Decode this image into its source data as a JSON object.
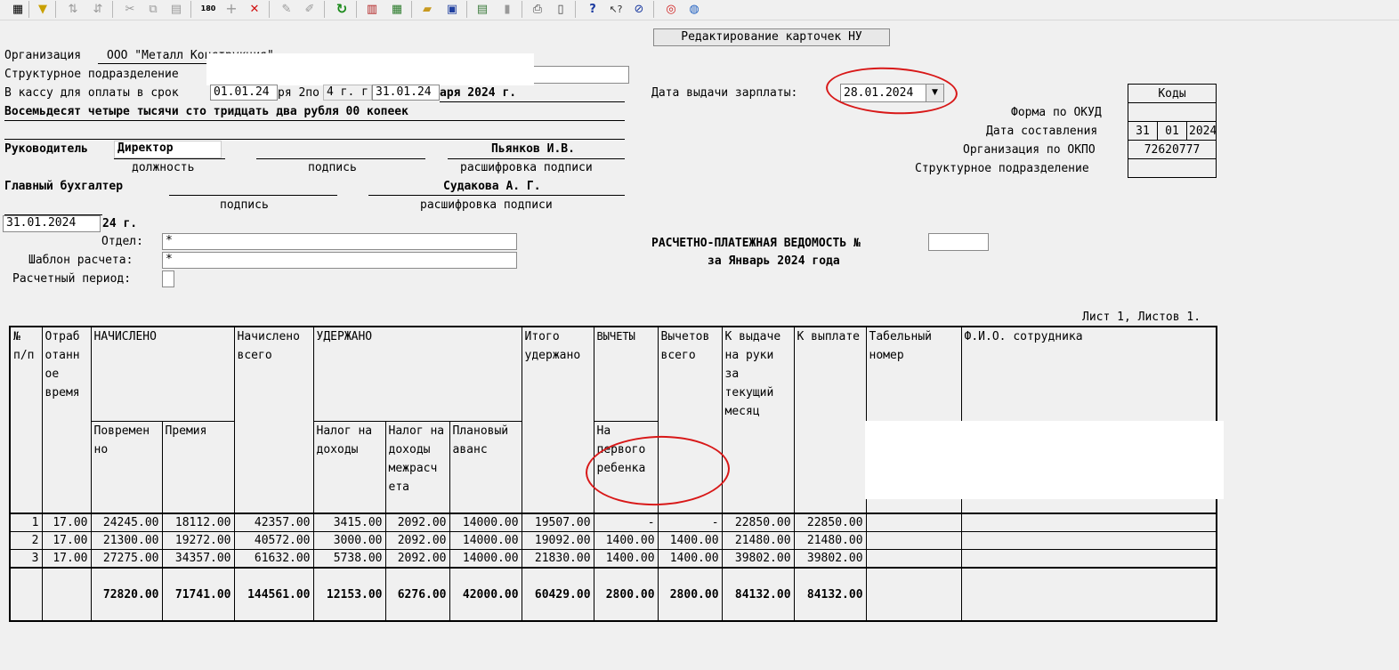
{
  "toolbar": {
    "icons": [
      "grid-icon",
      "filter-icon",
      "sort-asc-icon",
      "sort-desc-icon",
      "cut-icon",
      "copy-icon",
      "paste-icon",
      "counter-icon",
      "add-icon",
      "delete-icon",
      "pencil-icon",
      "edit-field-icon",
      "refresh-icon",
      "report-icon",
      "calculator-icon",
      "open-folder-icon",
      "save-icon",
      "export-icon",
      "document-icon",
      "print-icon",
      "preview-icon",
      "help-icon",
      "context-help-icon",
      "compass-icon",
      "lifebuoy-icon",
      "globe-icon"
    ],
    "counter_label": "180"
  },
  "title_button": "Редактирование карточек НУ",
  "org": {
    "label": "Организация",
    "value": "ООО \"Металл Конструкция\""
  },
  "subdivision": {
    "label": "Структурное подразделение",
    "value": ""
  },
  "cash": {
    "label": "В кассу для оплаты в срок",
    "from": "01.01.24",
    "mid_text": "ря 2по",
    "mid_text2": "4 г. г",
    "to": "31.01.24",
    "tail": "аря 2024 г."
  },
  "amount_words": "Восемьдесят четыре тысячи сто тридцать два рубля 00 копеек",
  "head": {
    "label": "Руководитель",
    "position": "Директор",
    "name": "Пьянков И.В.",
    "cap_position": "должность",
    "cap_signature": "подпись",
    "cap_decode": "расшифровка подписи"
  },
  "accountant": {
    "label": "Главный бухгалтер",
    "name": "Судакова А. Г.",
    "cap_signature": "подпись",
    "cap_decode": "расшифровка подписи"
  },
  "doc_date": {
    "value": "31.01.2024",
    "suffix": "24 г."
  },
  "dept": {
    "label": "Отдел:",
    "value": "*"
  },
  "template": {
    "label": "Шаблон расчета:",
    "value": "*"
  },
  "period": {
    "label": "Расчетный период:"
  },
  "pay_date": {
    "label": "Дата выдачи зарплаты:",
    "value": "28.01.2024"
  },
  "codes": {
    "header": "Коды",
    "okud_label": "Форма по ОКУД",
    "okud": "",
    "date_label": "Дата составления",
    "day": "31",
    "month": "01",
    "year": "2024",
    "okpo_label": "Организация по ОКПО",
    "okpo": "72620777",
    "sub_label": "Структурное подразделение",
    "sub": ""
  },
  "statement": {
    "title": "РАСЧЕТНО-ПЛАТЕЖНАЯ ВЕДОМОСТЬ №",
    "number": "",
    "period": "за Январь 2024 года"
  },
  "sheet_info": "Лист 1, Листов 1.",
  "table": {
    "h_num": "№ п/п",
    "h_worked": "Отраб отанн ое время",
    "h_accrued": "НАЧИСЛЕНО",
    "h_time": "Повремен но",
    "h_bonus": "Премия",
    "h_accrued_total": "Начислено всего",
    "h_withheld": "УДЕРЖАНО",
    "h_tax": "Налог на доходы",
    "h_tax_inter": "Налог на доходы межрасч ета",
    "h_advance": "Плановый аванс",
    "h_withheld_total": "Итого удержано",
    "h_deductions": "ВЫЧЕТЫ",
    "h_first_child": "На первого ребенка",
    "h_deductions_total": "Вычетов всего",
    "h_to_hand": "К выдаче на руки за текущий месяц",
    "h_to_pay": "К выплате",
    "h_tab_no": "Табельный номер",
    "h_fio": "Ф.И.О. сотрудника",
    "rows": [
      {
        "n": "1",
        "worked": "17.00",
        "time": "24245.00",
        "bonus": "18112.00",
        "acc_total": "42357.00",
        "tax": "3415.00",
        "tax_inter": "2092.00",
        "advance": "14000.00",
        "wh_total": "19507.00",
        "child": "-",
        "ded_total": "-",
        "hand": "22850.00",
        "pay": "22850.00"
      },
      {
        "n": "2",
        "worked": "17.00",
        "time": "21300.00",
        "bonus": "19272.00",
        "acc_total": "40572.00",
        "tax": "3000.00",
        "tax_inter": "2092.00",
        "advance": "14000.00",
        "wh_total": "19092.00",
        "child": "1400.00",
        "ded_total": "1400.00",
        "hand": "21480.00",
        "pay": "21480.00"
      },
      {
        "n": "3",
        "worked": "17.00",
        "time": "27275.00",
        "bonus": "34357.00",
        "acc_total": "61632.00",
        "tax": "5738.00",
        "tax_inter": "2092.00",
        "advance": "14000.00",
        "wh_total": "21830.00",
        "child": "1400.00",
        "ded_total": "1400.00",
        "hand": "39802.00",
        "pay": "39802.00"
      }
    ],
    "total": {
      "time": "72820.00",
      "bonus": "71741.00",
      "acc_total": "144561.00",
      "tax": "12153.00",
      "tax_inter": "6276.00",
      "advance": "42000.00",
      "wh_total": "60429.00",
      "child": "2800.00",
      "ded_total": "2800.00",
      "hand": "84132.00",
      "pay": "84132.00"
    }
  }
}
